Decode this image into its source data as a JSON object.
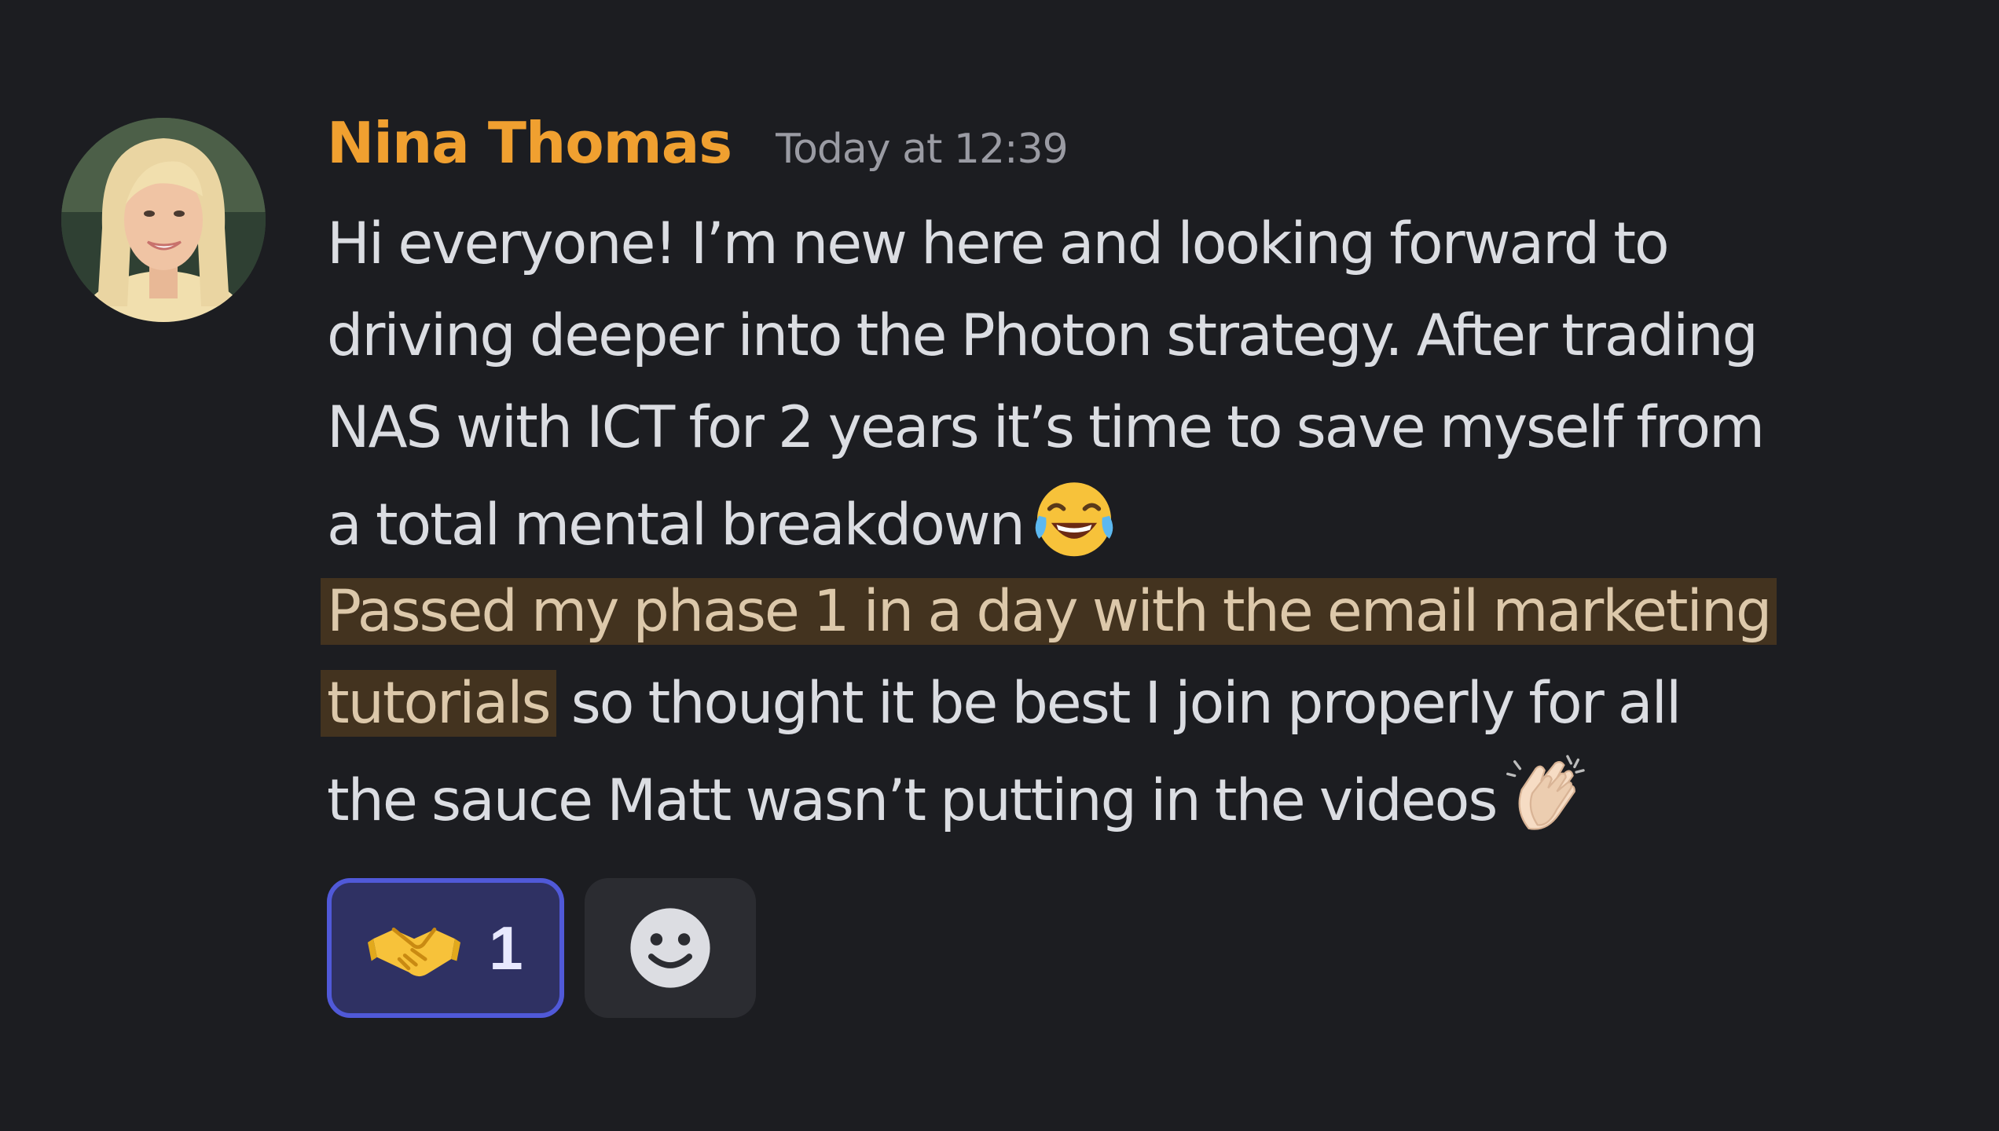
{
  "message": {
    "author": "Nina Thomas",
    "timestamp": "Today at 12:39",
    "author_color": "#f0a030",
    "lines": [
      "Hi everyone! I’m new here and looking forward to",
      "driving deeper into the Photon strategy. After trading",
      "NAS with ICT for 2 years it’s time to save myself from",
      "a total mental breakdown"
    ],
    "highlight_line1": "Passed my phase 1 in a day with the email marketing",
    "highlight_line2": "tutorials",
    "line6_rest": " so thought it be best I join properly for all",
    "line7": "the sauce Matt wasn’t putting in the videos",
    "emoji_1": "joy-emoji",
    "emoji_2": "clapping-hands-emoji",
    "highlight_color": "#43331f"
  },
  "reactions": [
    {
      "emoji": "handshake-emoji",
      "count": "1",
      "active": true
    }
  ],
  "add_reaction": {
    "icon": "smiley-face-icon"
  }
}
